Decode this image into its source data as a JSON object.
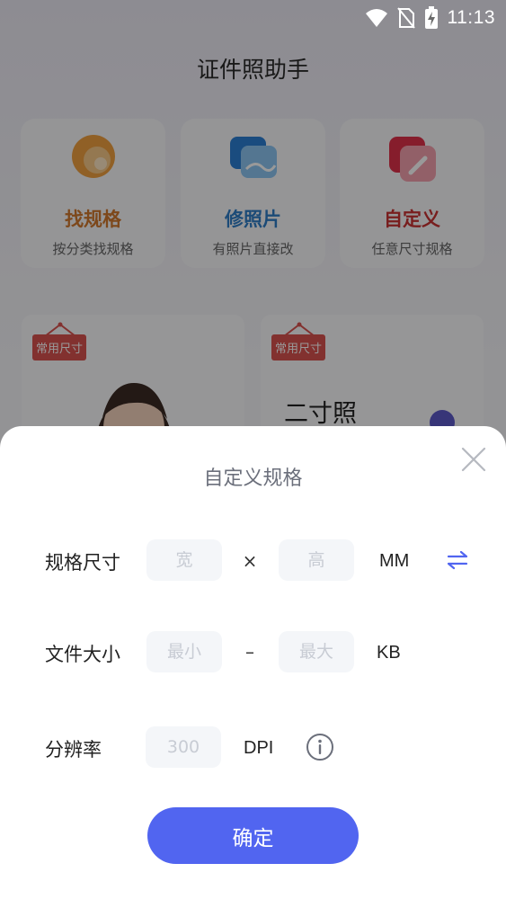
{
  "status_bar": {
    "time": "11:13",
    "icons": [
      "wifi-icon",
      "no-sim-icon",
      "battery-charging-icon"
    ]
  },
  "app": {
    "title": "证件照助手",
    "features": [
      {
        "title": "找规格",
        "subtitle": "按分类找规格",
        "icon": "search-spec-icon",
        "color": "#e07b2e"
      },
      {
        "title": "修照片",
        "subtitle": "有照片直接改",
        "icon": "photo-edit-icon",
        "color": "#2c7fd4"
      },
      {
        "title": "自定义",
        "subtitle": "任意尺寸规格",
        "icon": "custom-edit-icon",
        "color": "#d93b3b"
      }
    ],
    "size_cards": [
      {
        "tag": "常用尺寸",
        "title": ""
      },
      {
        "tag": "常用尺寸",
        "title": "二寸照"
      }
    ]
  },
  "sheet": {
    "title": "自定义规格",
    "rows": {
      "size": {
        "label": "规格尺寸",
        "width_placeholder": "宽",
        "height_placeholder": "高",
        "separator": "×",
        "unit": "MM"
      },
      "filesize": {
        "label": "文件大小",
        "min_placeholder": "最小",
        "max_placeholder": "最大",
        "separator": "–",
        "unit": "KB"
      },
      "resolution": {
        "label": "分辨率",
        "placeholder": "300",
        "unit": "DPI"
      }
    },
    "confirm_label": "确定"
  },
  "colors": {
    "accent": "#5165f0",
    "swap_icon": "#5165f0",
    "tag": "#d9534f"
  }
}
